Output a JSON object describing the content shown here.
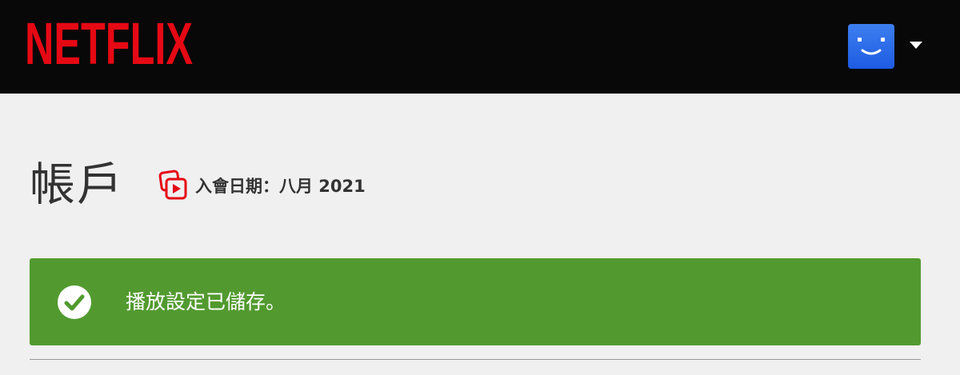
{
  "header": {
    "logo_text": "NETFLIX",
    "logo_color": "#e50914",
    "profile": {
      "avatar_icon": "smiley-face-icon",
      "avatar_color": "#2f72ea",
      "menu_icon": "caret-down-icon"
    }
  },
  "page": {
    "title": "帳戶",
    "member_since": {
      "icon": "member-since-icon",
      "text": "入會日期：八月 2021"
    }
  },
  "alert": {
    "icon": "check-circle-icon",
    "message": "播放設定已儲存。",
    "color": "#529a2f"
  }
}
